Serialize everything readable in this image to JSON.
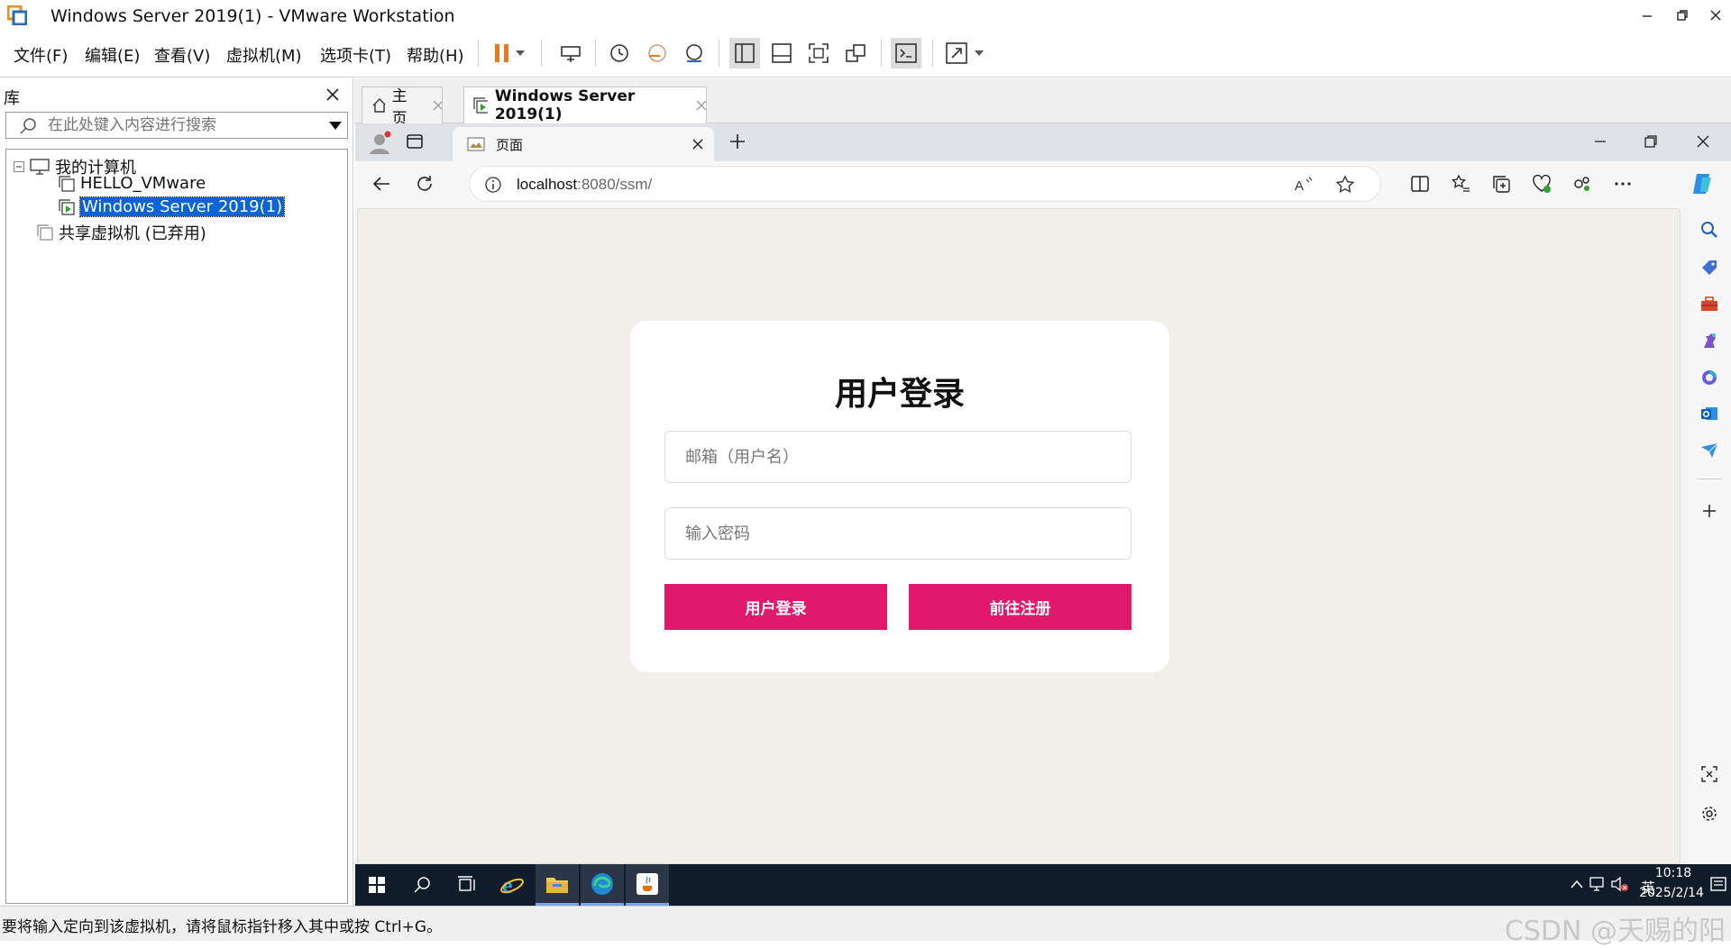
{
  "window": {
    "title": "Windows Server 2019(1) - VMware Workstation"
  },
  "menu": [
    "文件(F)",
    "编辑(E)",
    "查看(V)",
    "虚拟机(M)",
    "选项卡(T)",
    "帮助(H)"
  ],
  "library": {
    "title": "库",
    "search_placeholder": "在此处键入内容进行搜索",
    "tree": {
      "root": "我的计算机",
      "vm1": "HELLO_VMware",
      "vm2": "Windows Server 2019(1)",
      "shared": "共享虚拟机 (已弃用)"
    }
  },
  "vm_tabs": {
    "home": "主页",
    "active": "Windows Server 2019(1)"
  },
  "browser": {
    "tab_title": "页面",
    "url_host": "localhost",
    "url_rest": ":8080/ssm/"
  },
  "login": {
    "title": "用户登录",
    "email_placeholder": "邮箱（用户名）",
    "password_placeholder": "输入密码",
    "login_button": "用户登录",
    "register_button": "前往注册",
    "accent_color": "#e0196d"
  },
  "taskbar": {
    "time": "10:18",
    "date": "2025/2/14",
    "ime": "英"
  },
  "status": {
    "text": "要将输入定向到该虚拟机，请将鼠标指针移入其中或按 Ctrl+G。",
    "watermark": "CSDN @天赐的阳"
  }
}
